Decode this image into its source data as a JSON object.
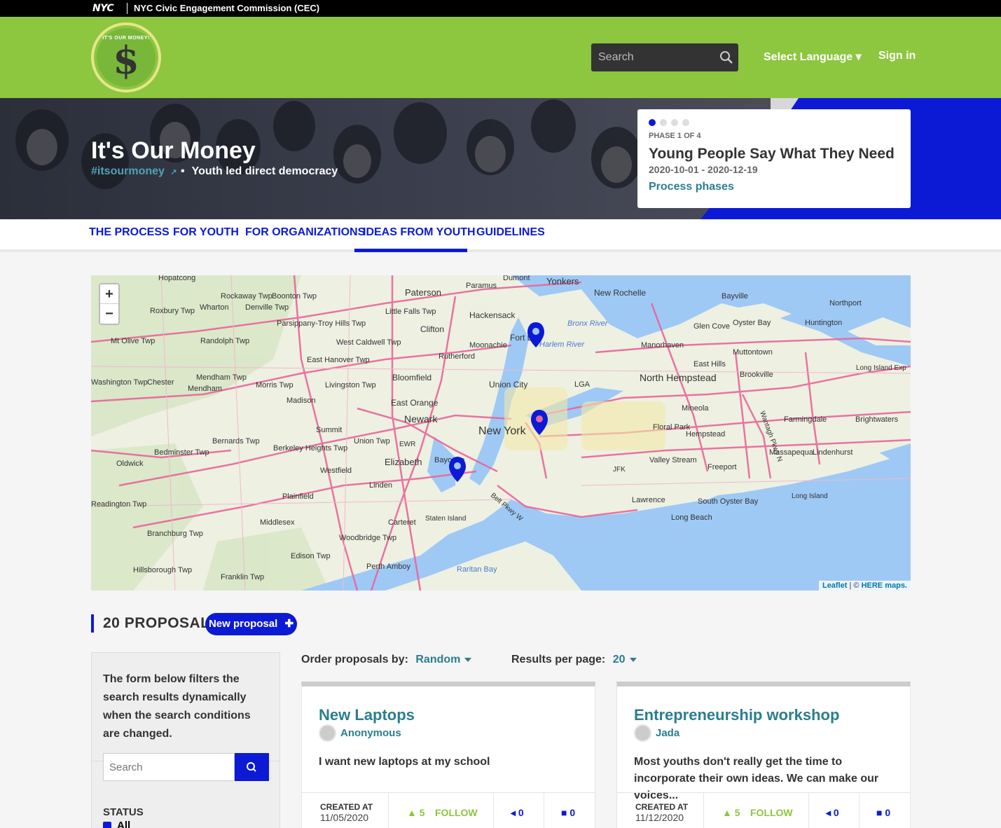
{
  "nyc_bar": {
    "logo": "NYC",
    "org": "NYC Civic Engagement Commission (CEC)"
  },
  "header": {
    "logo_ring_text": "IT'S OUR MONEY!",
    "logo_symbol": "$",
    "search_placeholder": "Search",
    "language": "Select Language ▾",
    "signin": "Sign in"
  },
  "hero": {
    "title": "It's Our Money",
    "hashtag": "#itsourmoney",
    "subtitle": "Youth led direct democracy",
    "phase": {
      "label": "PHASE 1 OF 4",
      "title": "Young People Say What They Need",
      "dates": "2020-10-01 - 2020-12-19",
      "link": "Process phases"
    }
  },
  "tabs": [
    "THE PROCESS",
    "FOR YOUTH",
    "FOR ORGANIZATIONS",
    "IDEAS FROM YOUTH",
    "GUIDELINES"
  ],
  "map": {
    "zoom_in": "+",
    "zoom_out": "−",
    "attribution_leaflet": "Leaflet",
    "attribution_sep": " | © ",
    "attribution_here": "HERE maps.",
    "labels": [
      "Hopatcong",
      "Paterson",
      "Paramus",
      "Dumont",
      "Yonkers",
      "New Rochelle",
      "Bayville",
      "Northport",
      "Rockaway Twp",
      "Boonton Twp",
      "Hackensack",
      "Little Falls Twp",
      "Roxbury Twp",
      "Wharton",
      "Denville Twp",
      "Parsippany-Troy Hills Twp",
      "Clifton",
      "Fort Lee",
      "Oyster Bay",
      "Huntington",
      "Glen Cove",
      "West Caldwell Twp",
      "Moonachie",
      "Mt Olive Twp",
      "Randolph Twp",
      "East Hanover Twp",
      "Rutherford",
      "Manorhaven",
      "Muttontown",
      "Bronx River",
      "Harlem River",
      "North Hempstead",
      "East Hills",
      "Brookville",
      "Long Island Exp",
      "Mendham Twp",
      "Morris Twp",
      "Livingston Twp",
      "Bloomfield",
      "Union City",
      "LGA",
      "Washington Twp",
      "Chester",
      "Mendham",
      "Madison",
      "East Orange",
      "Mineola",
      "Newark",
      "New York",
      "Floral Park",
      "Farmingdale",
      "Brightwaters",
      "Summit",
      "Hempstead",
      "Bernards Twp",
      "Union Twp",
      "EWR",
      "Massapequa",
      "Lindenhurst",
      "Bedminster Twp",
      "Berkeley Heights Twp",
      "Elizabeth",
      "Bayonne",
      "Oldwick",
      "Westfield",
      "Valley Stream",
      "Freeport",
      "JFK",
      "Linden",
      "Plainfield",
      "Wantagh Pkwy N",
      "Readington Twp",
      "Middlesex",
      "Lawrence",
      "South Oyster Bay",
      "Long Island",
      "Carteret",
      "Staten Island",
      "Long Beach",
      "Branchburg Twp",
      "Belt Pkwy W",
      "Woodbridge Twp",
      "Edison Twp",
      "Perth Amboy",
      "Hillsborough Twp",
      "Franklin Twp",
      "Raritan Bay"
    ]
  },
  "proposals": {
    "count_label": "20 PROPOSALS",
    "new_button": "New proposal",
    "filter_text": "The form below filters the search results dynamically when the search conditions are changed.",
    "filter_search_placeholder": "Search",
    "status_label": "STATUS",
    "status_all": "All",
    "order_label": "Order proposals by:",
    "order_value": "Random",
    "perpage_label": "Results per page:",
    "perpage_value": "20",
    "cards": [
      {
        "title": "New Laptops",
        "author": "Anonymous",
        "body": "I want new laptops at my school",
        "created_label": "CREATED AT",
        "created_date": "11/05/2020",
        "votes": "5",
        "follow": "FOLLOW",
        "endorsements": "0",
        "comments": "0"
      },
      {
        "title": "Entrepreneurship workshop",
        "author": "Jada",
        "body": "Most youths don't really get the time to incorporate their own ideas. We can make our voices...",
        "created_label": "CREATED AT",
        "created_date": "11/12/2020",
        "votes": "5",
        "follow": "FOLLOW",
        "endorsements": "0",
        "comments": "0"
      }
    ]
  },
  "colors": {
    "nyc_green": "#8dc63f",
    "primary_blue": "#0c1ad6",
    "teal_link": "#2a7e8f",
    "water": "#9ec9f5",
    "road": "#e8669a"
  }
}
